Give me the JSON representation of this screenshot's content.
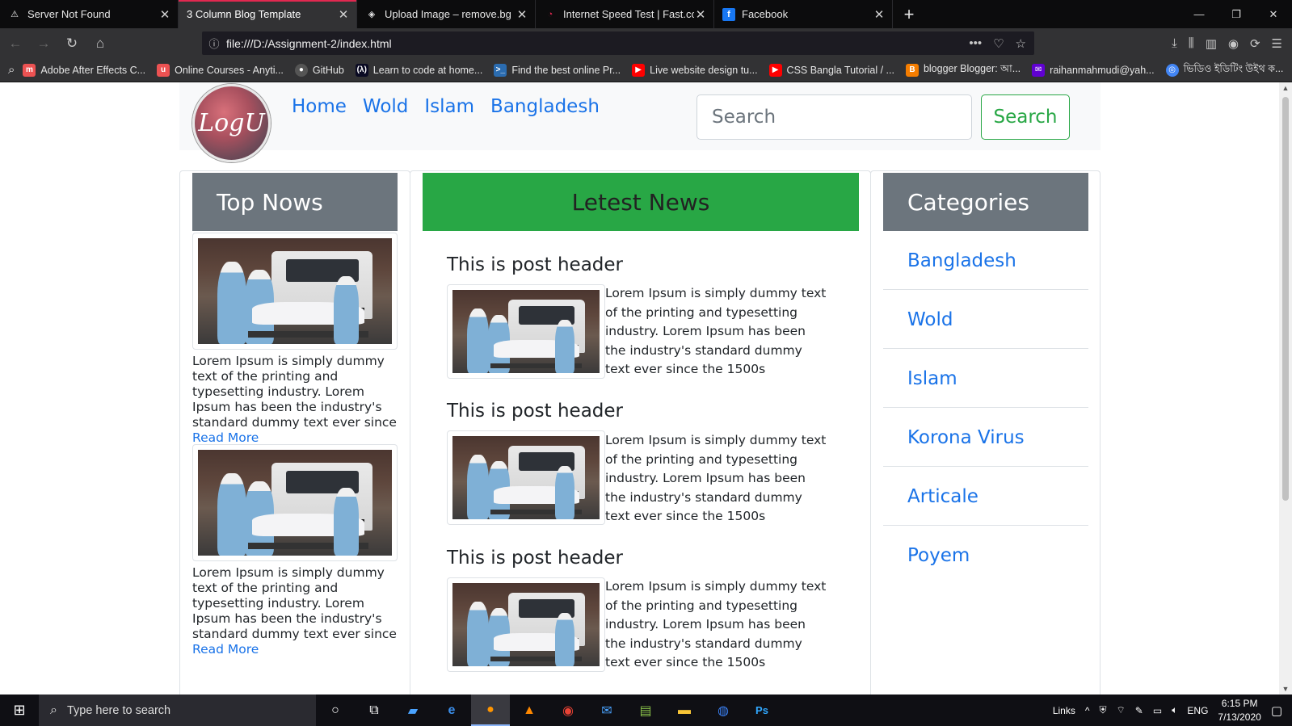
{
  "browser": {
    "tabs": [
      {
        "title": "Server Not Found",
        "icon": "warning-icon",
        "active": false
      },
      {
        "title": "3 Column Blog Template",
        "icon": "",
        "active": true
      },
      {
        "title": "Upload Image – remove.bg",
        "icon": "layers-icon",
        "active": false
      },
      {
        "title": "Internet Speed Test | Fast.com",
        "icon": "speedometer-icon",
        "active": false
      },
      {
        "title": "Facebook",
        "icon": "facebook-icon",
        "active": false
      }
    ],
    "url": "file:///D:/Assignment-2/index.html",
    "bookmarks": [
      {
        "label": "Adobe After Effects C...",
        "icon": "udemy-icon",
        "color": "#ec5252"
      },
      {
        "label": "Online Courses - Anyti...",
        "icon": "udemy-icon",
        "color": "#ec5252"
      },
      {
        "label": "GitHub",
        "icon": "github-icon",
        "color": "#555555"
      },
      {
        "label": "Learn to code at home...",
        "icon": "freecodecamp-icon",
        "color": "#0a0a23"
      },
      {
        "label": "Find the best online Pr...",
        "icon": "terminal-icon",
        "color": "#2b6cb0"
      },
      {
        "label": "Live website design tu...",
        "icon": "youtube-icon",
        "color": "#ff0000"
      },
      {
        "label": "CSS Bangla Tutorial / ...",
        "icon": "youtube-icon",
        "color": "#ff0000"
      },
      {
        "label": "blogger Blogger: আ...",
        "icon": "blogger-icon",
        "color": "#f57d00"
      },
      {
        "label": "raihanmahmudi@yah...",
        "icon": "yahoo-mail-icon",
        "color": "#6001d2"
      },
      {
        "label": "ভিডিও ইডিটিং উইথ ক...",
        "icon": "chrome-icon",
        "color": "#4285f4"
      }
    ]
  },
  "site": {
    "logo_text": "LogU",
    "nav": [
      "Home",
      "Wold",
      "Islam",
      "Bangladesh"
    ],
    "search_placeholder": "Search",
    "search_button": "Search"
  },
  "left": {
    "title": "Top Nows",
    "items": [
      {
        "text": "Lorem Ipsum is simply dummy text of the printing and typesetting industry. Lorem Ipsum has been the industry's standard dummy text ever since",
        "link": "Read More"
      },
      {
        "text": "Lorem Ipsum is simply dummy text of the printing and typesetting industry. Lorem Ipsum has been the industry's standard dummy text ever since",
        "link": "Read More"
      }
    ]
  },
  "middle": {
    "title": "Letest News",
    "posts": [
      {
        "header": "This is post header",
        "text": "Lorem Ipsum is simply dummy text of the printing and typesetting industry. Lorem Ipsum has been the industry's standard dummy text ever since the 1500s"
      },
      {
        "header": "This is post header",
        "text": "Lorem Ipsum is simply dummy text of the printing and typesetting industry. Lorem Ipsum has been the industry's standard dummy text ever since the 1500s"
      },
      {
        "header": "This is post header",
        "text": "Lorem Ipsum is simply dummy text of the printing and typesetting industry. Lorem Ipsum has been the industry's standard dummy text ever since the 1500s"
      }
    ]
  },
  "right": {
    "title": "Categories",
    "items": [
      "Bangladesh",
      "Wold",
      "Islam",
      "Korona Virus",
      "Articale",
      "Poyem"
    ]
  },
  "taskbar": {
    "search_placeholder": "Type here to search",
    "tray_links": "Links",
    "language": "ENG",
    "time": "6:15 PM",
    "date": "7/13/2020"
  }
}
